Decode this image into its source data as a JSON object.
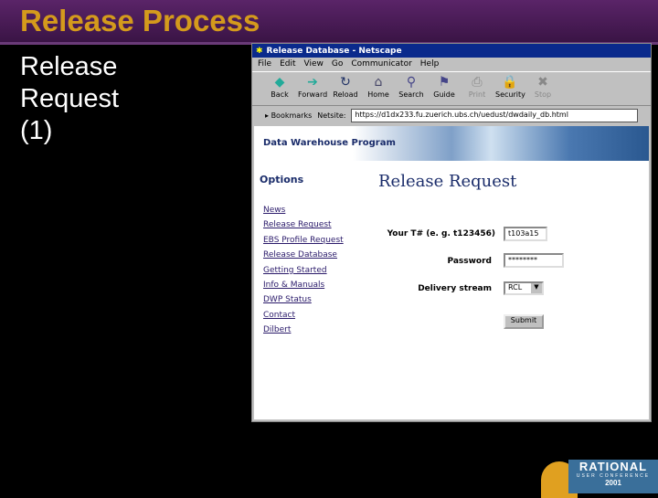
{
  "slide": {
    "title": "Release Process",
    "subtitle": "Release Request (1)"
  },
  "browser": {
    "window_title": "Release Database - Netscape",
    "menu": [
      "File",
      "Edit",
      "View",
      "Go",
      "Communicator",
      "Help"
    ],
    "toolbar": [
      {
        "label": "Back",
        "icon": "◆"
      },
      {
        "label": "Forward",
        "icon": "➔"
      },
      {
        "label": "Reload",
        "icon": "↻"
      },
      {
        "label": "Home",
        "icon": "⌂"
      },
      {
        "label": "Search",
        "icon": "⚲"
      },
      {
        "label": "Guide",
        "icon": "⚑"
      },
      {
        "label": "Print",
        "icon": "⎙"
      },
      {
        "label": "Security",
        "icon": "🔒"
      },
      {
        "label": "Stop",
        "icon": "✖"
      }
    ],
    "bookmarks_label": "Bookmarks",
    "location_label": "Netsite:",
    "url": "https://d1dx233.fu.zuerich.ubs.ch/uedust/dwdaily_db.html"
  },
  "page": {
    "banner": "Data Warehouse Program",
    "options_heading": "Options",
    "links": [
      "News",
      "Release Request",
      "EBS Profile Request",
      "Release Database",
      "Getting Started",
      "Info & Manuals",
      "DWP Status",
      "Contact",
      "Dilbert"
    ],
    "heading": "Release Request",
    "form": {
      "t_label": "Your T# (e. g. t123456)",
      "t_value": "t103a15",
      "password_label": "Password",
      "password_value": "********",
      "stream_label": "Delivery stream",
      "stream_value": "RCL",
      "submit": "Submit"
    }
  },
  "logo": {
    "name": "RATIONAL",
    "line2": "USER CONFERENCE",
    "year": "2001"
  }
}
